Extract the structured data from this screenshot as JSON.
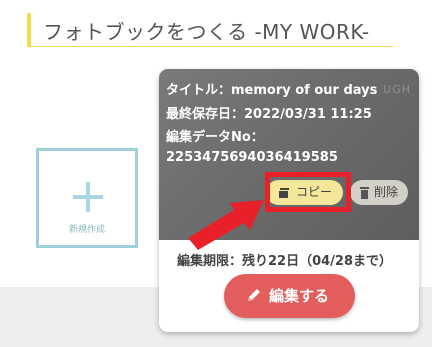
{
  "section": {
    "title": "フォトブックをつくる -MY WORK-"
  },
  "new_card": {
    "label": "新規作成",
    "icon": "plus-icon"
  },
  "work": {
    "title_line": "タイトル：memory of our days",
    "saved_line": "最終保存日：2022/03/31 11:25",
    "data_no_label": "編集データNo：",
    "data_no": "2253475694036419585",
    "watermark": "UGH",
    "copy_label": "コピー",
    "delete_label": "削除",
    "deadline": "編集期限：残り22日（04/28まで）",
    "edit_label": "編集する"
  },
  "colors": {
    "title_accent": "#f2dd4e",
    "new_card_border": "#9fcfdb",
    "copy_button": "#f4e79a",
    "edit_button": "#e35d5d",
    "highlight": "#e8202a"
  }
}
